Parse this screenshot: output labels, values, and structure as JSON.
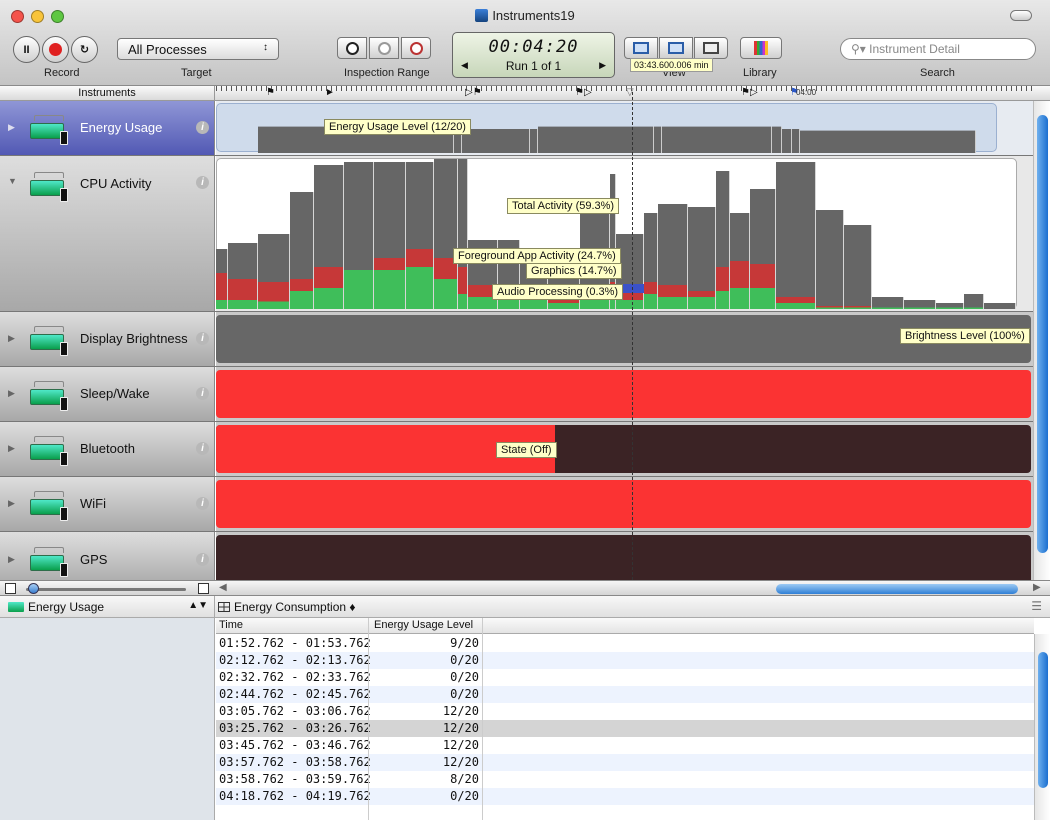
{
  "window": {
    "title": "Instruments19"
  },
  "toolbar": {
    "record_label": "Record",
    "target_label": "Target",
    "target_value": "All Processes",
    "inspection_label": "Inspection Range",
    "timer": "00:04:20",
    "run": "Run 1 of 1",
    "view_label": "View",
    "library_label": "Library",
    "search_label": "Search",
    "search_placeholder": "Instrument Detail",
    "tooltip": "03:43.600.006 min"
  },
  "ruler": {
    "instruments_label": "Instruments",
    "tick_label": "04:00"
  },
  "instruments": [
    {
      "name": "Energy Usage",
      "tag": "Energy Usage Level (12/20)"
    },
    {
      "name": "CPU Activity",
      "tags": [
        "Total Activity (59.3%)",
        "Foreground App Activity (24.7%)",
        "Graphics (14.7%)",
        "Audio Processing (0.3%)"
      ]
    },
    {
      "name": "Display Brightness",
      "tag": "Brightness Level (100%)"
    },
    {
      "name": "Sleep/Wake"
    },
    {
      "name": "Bluetooth",
      "tag": "State (Off)"
    },
    {
      "name": "WiFi"
    },
    {
      "name": "GPS"
    }
  ],
  "colors": {
    "selected": "#5c62bf",
    "gray_bar": "#666666",
    "red": "#fb3333",
    "dark": "#3b2325",
    "green": "#3fbe5a",
    "blue": "#3b52c9"
  },
  "detail": {
    "left_title": "Energy Usage",
    "right_title": "Energy Consumption",
    "columns": [
      "Time",
      "Energy Usage Level"
    ],
    "rows": [
      [
        "01:52.762 - 01:53.762",
        "9/20"
      ],
      [
        "02:12.762 - 02:13.762",
        "0/20"
      ],
      [
        "02:32.762 - 02:33.762",
        "0/20"
      ],
      [
        "02:44.762 - 02:45.762",
        "0/20"
      ],
      [
        "03:05.762 - 03:06.762",
        "12/20"
      ],
      [
        "03:25.762 - 03:26.762",
        "12/20"
      ],
      [
        "03:45.762 - 03:46.762",
        "12/20"
      ],
      [
        "03:57.762 - 03:58.762",
        "12/20"
      ],
      [
        "03:58.762 - 03:59.762",
        "8/20"
      ],
      [
        "04:18.762 - 04:19.762",
        "0/20"
      ]
    ],
    "selected_row": 5
  },
  "charts": {
    "energy": [
      [
        0,
        0
      ],
      [
        42,
        0.66
      ],
      [
        238,
        0.66
      ],
      [
        246,
        0.6
      ],
      [
        314,
        0.6
      ],
      [
        322,
        0.66
      ],
      [
        438,
        0.66
      ],
      [
        446,
        0.66
      ],
      [
        556,
        0.66
      ],
      [
        566,
        0.6
      ],
      [
        576,
        0.6
      ],
      [
        584,
        0.56
      ],
      [
        760,
        0.56
      ]
    ],
    "cpu": [
      [
        0,
        0.4,
        0.24,
        0.06
      ],
      [
        12,
        0.44,
        0.2,
        0.06
      ],
      [
        42,
        0.5,
        0.18,
        0.05
      ],
      [
        74,
        0.78,
        0.2,
        0.12
      ],
      [
        98,
        0.96,
        0.28,
        0.14
      ],
      [
        128,
        0.98,
        0.26,
        0.26
      ],
      [
        158,
        0.98,
        0.34,
        0.26
      ],
      [
        190,
        0.98,
        0.4,
        0.28
      ],
      [
        218,
        1.0,
        0.34,
        0.2
      ],
      [
        242,
        1.0,
        0.28,
        0.1
      ],
      [
        252,
        0.46,
        0.16,
        0.08
      ],
      [
        282,
        0.46,
        0.12,
        0.06
      ],
      [
        304,
        0.4,
        0.1,
        0.06
      ],
      [
        332,
        0.28,
        0.1,
        0.04
      ],
      [
        364,
        0.7,
        0.16,
        0.06
      ],
      [
        394,
        0.9,
        0.18,
        0.14
      ],
      [
        400,
        0.5,
        0.16,
        0.06
      ],
      [
        428,
        0.64,
        0.18,
        0.1
      ],
      [
        442,
        0.7,
        0.16,
        0.08
      ],
      [
        472,
        0.68,
        0.12,
        0.08
      ],
      [
        500,
        0.92,
        0.28,
        0.12
      ],
      [
        514,
        0.64,
        0.32,
        0.14
      ],
      [
        534,
        0.8,
        0.3,
        0.14
      ],
      [
        560,
        0.98,
        0.08,
        0.04
      ],
      [
        600,
        0.66,
        0.02,
        0.01
      ],
      [
        628,
        0.56,
        0.02,
        0.01
      ],
      [
        656,
        0.08,
        0,
        0.01
      ],
      [
        688,
        0.06,
        0,
        0.01
      ],
      [
        720,
        0.04,
        0,
        0.01
      ],
      [
        748,
        0.1,
        0,
        0.01
      ],
      [
        768,
        0.04,
        0,
        0
      ]
    ]
  }
}
